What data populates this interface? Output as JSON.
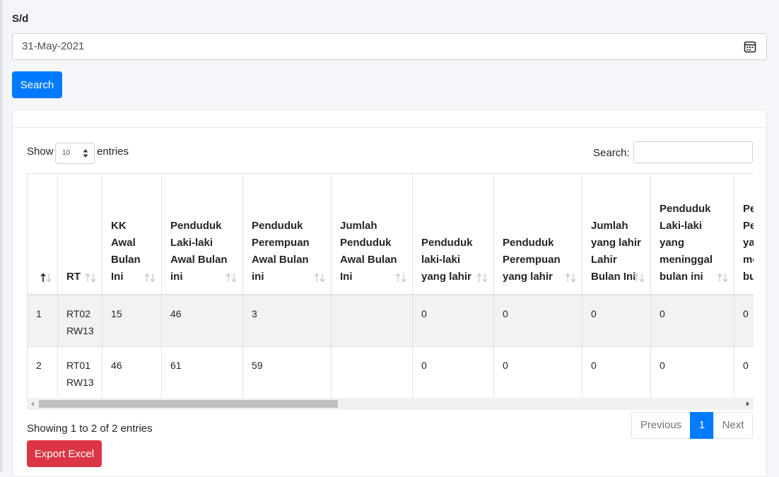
{
  "filter": {
    "date_label": "S/d",
    "date_value": "31-May-2021",
    "search_button": "Search"
  },
  "table_controls": {
    "show_label": "Show",
    "page_length": "10",
    "entries_label": "entries",
    "search_label": "Search:"
  },
  "table": {
    "columns": [
      "",
      "RT",
      "KK Awal Bulan Ini",
      "Penduduk Laki-laki Awal Bulan ini",
      "Penduduk Perempuan Awal Bulan ini",
      "Jumlah Penduduk Awal Bulan Ini",
      "Penduduk laki-laki yang lahir",
      "Penduduk Perempuan yang lahir",
      "Jumlah yang lahir Lahir Bulan Ini",
      "Penduduk Laki-laki yang meninggal bulan ini",
      "Penduduk Perempuan yang meninggal bulan ini"
    ],
    "rows": [
      [
        "1",
        "RT02 RW13",
        "15",
        "46",
        "3",
        "",
        "0",
        "0",
        "0",
        "0",
        "0"
      ],
      [
        "2",
        "RT01 RW13",
        "46",
        "61",
        "59",
        "",
        "0",
        "0",
        "0",
        "0",
        "0"
      ]
    ]
  },
  "footer": {
    "info": "Showing 1 to 2 of 2 entries",
    "previous": "Previous",
    "current_page": "1",
    "next": "Next",
    "export_button": "Export Excel"
  }
}
